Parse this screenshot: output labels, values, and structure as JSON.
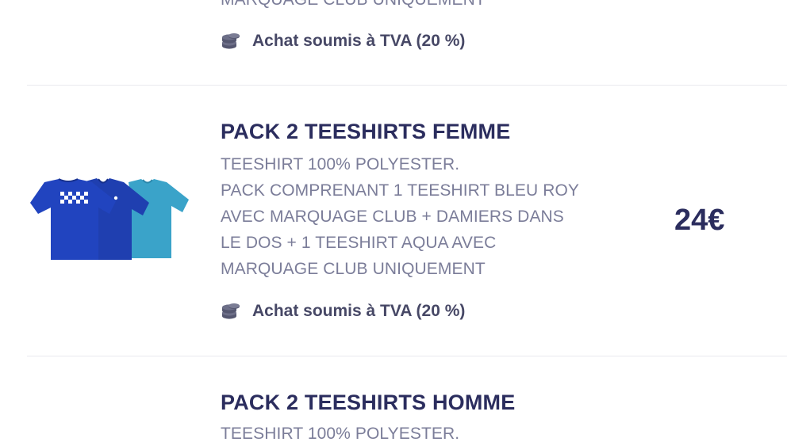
{
  "previous_item": {
    "description_last_line": "MARQUAGE CLUB UNIQUEMENT",
    "tva_label": "Achat soumis à TVA (20 %)"
  },
  "items": [
    {
      "title": "PACK 2 TEESHIRTS FEMME",
      "description_lines": [
        "TEESHIRT 100% POLYESTER.",
        "PACK COMPRENANT 1 TEESHIRT BLEU ROY",
        "AVEC MARQUAGE CLUB + DAMIERS DANS",
        "LE DOS + 1 TEESHIRT AQUA AVEC",
        "MARQUAGE CLUB UNIQUEMENT"
      ],
      "tva_label": "Achat soumis à TVA (20 %)",
      "price": "24€",
      "image_icon": "teeshirt-pack-image"
    },
    {
      "title": "PACK 2 TEESHIRTS HOMME",
      "description_lines": [
        "TEESHIRT 100% POLYESTER."
      ]
    }
  ],
  "colors": {
    "title": "#2b2d5e",
    "description": "#7b7d99",
    "tva_text": "#474866",
    "divider": "#e9e9ee",
    "shirt_royal": "#1f3fb0",
    "shirt_aqua": "#3aa3c9"
  }
}
